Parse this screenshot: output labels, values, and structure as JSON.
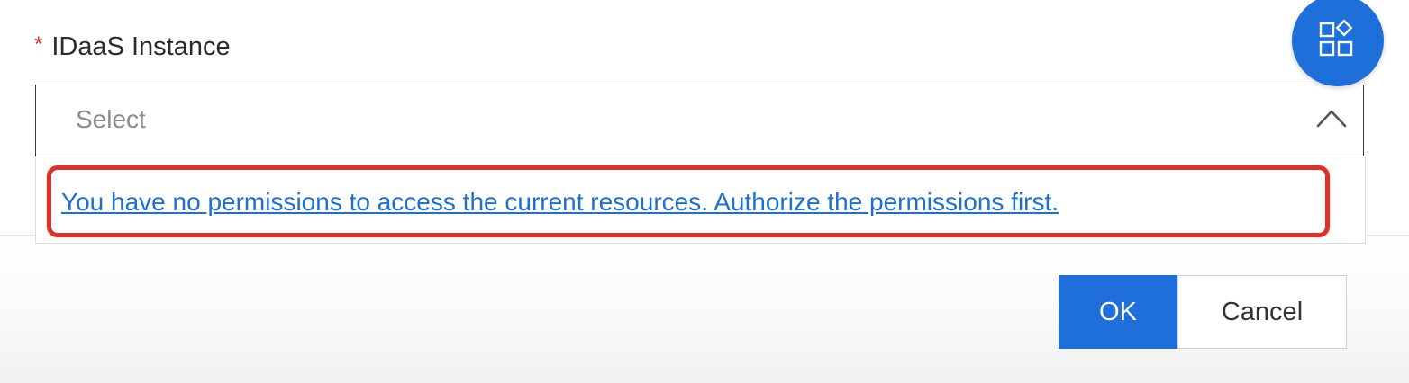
{
  "form": {
    "required_mark": "*",
    "field_label": "IDaaS Instance",
    "select": {
      "placeholder": "Select",
      "expanded": true
    },
    "dropdown_message": "You have no permissions to access the current resources. Authorize the permissions first."
  },
  "footer": {
    "ok_label": "OK",
    "cancel_label": "Cancel"
  },
  "fab": {
    "icon": "apps-grid-icon"
  },
  "colors": {
    "primary": "#1e6fd9",
    "required": "#d9342b",
    "highlight": "#e0302a",
    "link": "#1d6fd6"
  }
}
